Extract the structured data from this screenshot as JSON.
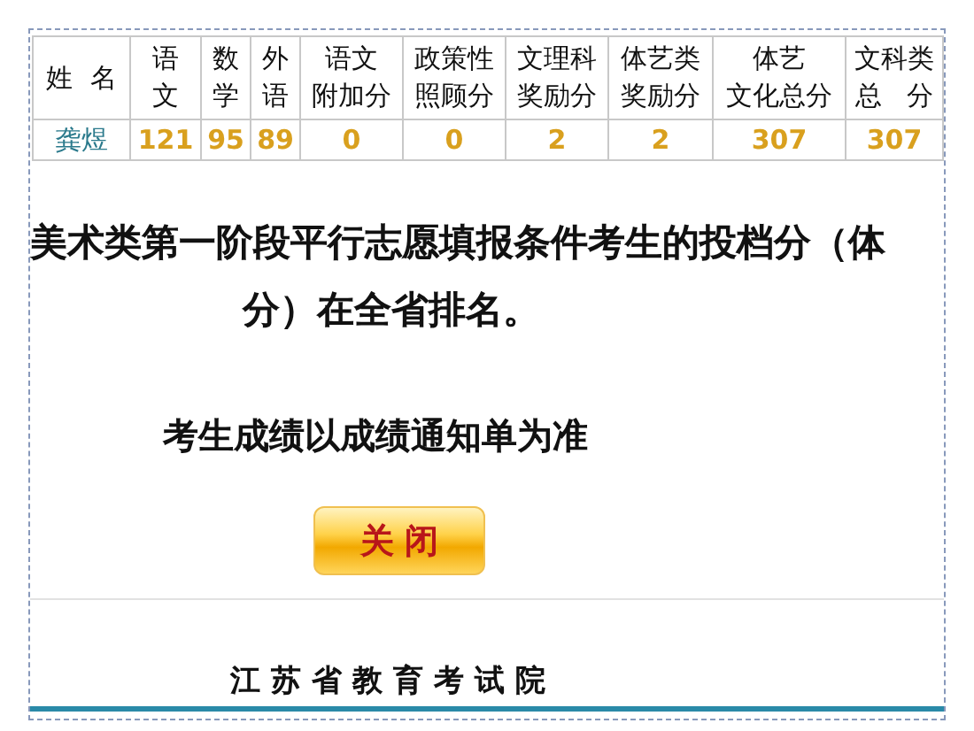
{
  "table": {
    "columns": [
      {
        "lines": [
          "姓  名"
        ]
      },
      {
        "lines": [
          "语",
          "文"
        ]
      },
      {
        "lines": [
          "数",
          "学"
        ]
      },
      {
        "lines": [
          "外",
          "语"
        ]
      },
      {
        "lines": [
          "语文",
          "附加分"
        ]
      },
      {
        "lines": [
          "政策性",
          "照顾分"
        ]
      },
      {
        "lines": [
          "文理科",
          "奖励分"
        ]
      },
      {
        "lines": [
          "体艺类",
          "奖励分"
        ]
      },
      {
        "lines": [
          "体艺",
          "文化总分"
        ]
      },
      {
        "lines": [
          "文科类",
          "总   分"
        ]
      }
    ],
    "rows": [
      {
        "name": "龚煜",
        "scores": [
          "121",
          "95",
          "89",
          "0",
          "0",
          "2",
          "2",
          "307",
          "307"
        ]
      }
    ]
  },
  "notice": {
    "line_1": "美术类第一阶段平行志愿填报条件考生的投档分（体",
    "line_2": "分）在全省排名。"
  },
  "note": "考生成绩以成绩通知单为准",
  "close_button": "关闭",
  "footer": "江苏省教育考试院"
}
